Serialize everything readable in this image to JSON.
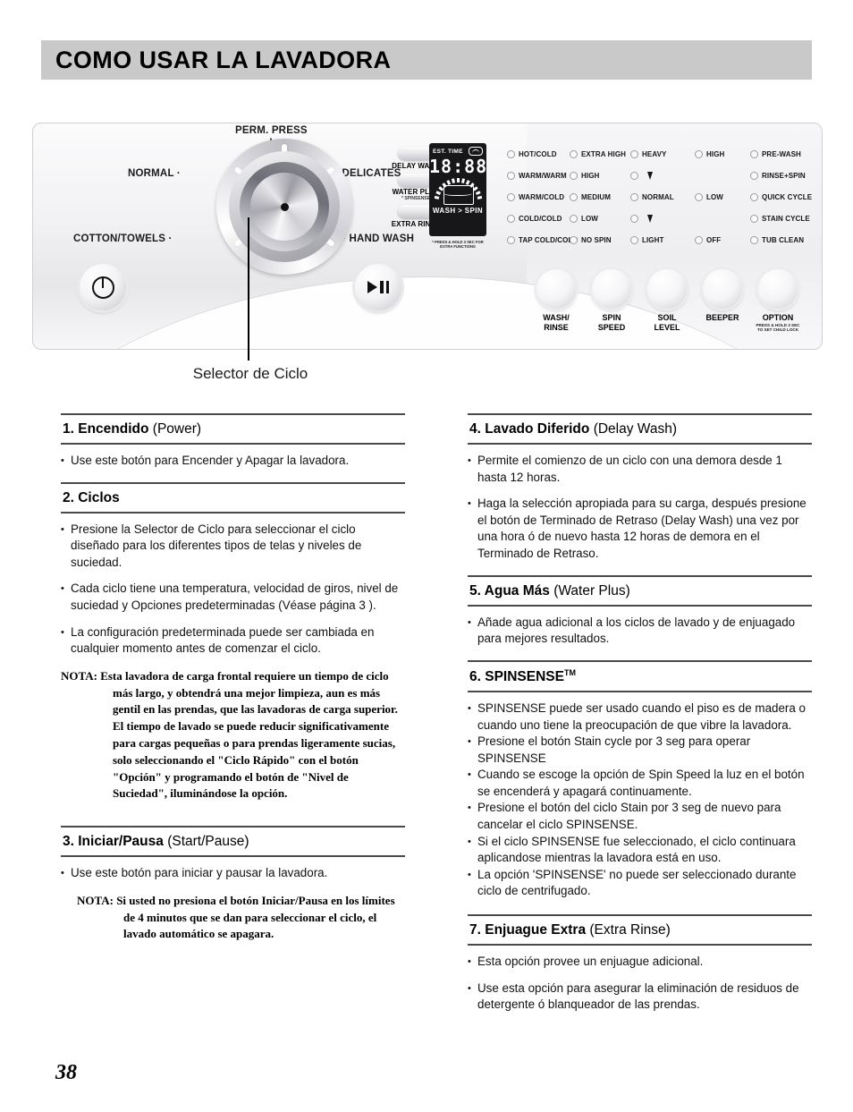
{
  "header": {
    "title": "COMO USAR LA LAVADORA"
  },
  "panel": {
    "dial": {
      "cycles": [
        {
          "label": "PERM. PRESS"
        },
        {
          "label": "NORMAL"
        },
        {
          "label": "COTTON/TOWELS"
        },
        {
          "label": "DELICATES"
        },
        {
          "label": "HAND WASH"
        }
      ]
    },
    "power_button": "power-icon",
    "start_button": "play-pause-icon",
    "pills": [
      {
        "label": "DELAY\nWASH",
        "sub": ""
      },
      {
        "label": "WATER PLUS",
        "sub": "* SPINSENSE"
      },
      {
        "label": "EXTRA RINSE",
        "sub": ""
      }
    ],
    "lcd": {
      "est_time_label": "EST. TIME",
      "digits": "18:88",
      "progress_label": "WASH > SPIN",
      "footnote": "* PRESS & HOLD 3 SEC\nFOR EXTRA FUNCTIONS"
    },
    "indicator_rows": [
      [
        "HOT/COLD",
        "EXTRA HIGH",
        "HEAVY",
        "HIGH",
        "PRE-WASH"
      ],
      [
        "WARM/WARM",
        "HIGH",
        "",
        "",
        "RINSE+SPIN"
      ],
      [
        "WARM/COLD",
        "MEDIUM",
        "NORMAL",
        "LOW",
        "QUICK CYCLE"
      ],
      [
        "COLD/COLD",
        "LOW",
        "",
        "",
        "STAIN CYCLE"
      ],
      [
        "TAP COLD/COLD",
        "NO SPIN",
        "LIGHT",
        "OFF",
        "TUB CLEAN"
      ]
    ],
    "option_buttons": [
      {
        "label": "WASH/\nRINSE",
        "sub": ""
      },
      {
        "label": "SPIN\nSPEED",
        "sub": ""
      },
      {
        "label": "SOIL\nLEVEL",
        "sub": ""
      },
      {
        "label": "BEEPER",
        "sub": ""
      },
      {
        "label": "OPTION",
        "sub": "PRESS & HOLD 3 SEC\nTO SET CHILD LOCK"
      }
    ]
  },
  "callout": {
    "label": "Selector de Ciclo"
  },
  "sections": {
    "s1": {
      "number_title": "1. Encendido",
      "paren": "(Power)",
      "bullets": [
        "Use este botón para Encender y Apagar la lavadora."
      ]
    },
    "s2": {
      "number_title": "2. Ciclos",
      "paren": "",
      "bullets": [
        "Presione la Selector de Ciclo para seleccionar el ciclo diseñado para los diferentes tipos de telas y niveles de suciedad.",
        "Cada ciclo tiene una temperatura, velocidad de giros, nivel de suciedad y Opciones predeterminadas (Véase página 3  ).",
        "La configuración predeterminada puede ser cambiada en cualquier momento antes de comenzar el ciclo."
      ],
      "note_label": "NOTA:",
      "note_body": "Esta lavadora de carga frontal requiere un tiempo de ciclo más largo, y obtendrá una mejor limpieza, aun es más gentil en las prendas, que las lavadoras de carga superior. El tiempo de lavado se puede reducir significativamente para cargas pequeñas o para prendas ligeramente sucias, solo seleccionando el \"Ciclo Rápido\" con el botón \"Opción\" y programando el botón de \"Nivel de Suciedad\", iluminándose la opción."
    },
    "s3": {
      "number_title": "3. Iniciar/Pausa",
      "paren": "(Start/Pause)",
      "bullets": [
        "Use este botón para iniciar y pausar la lavadora."
      ],
      "note_label": "NOTA:",
      "note_body": "Si usted no presiona el botón Iniciar/Pausa en los límites de 4 minutos que se dan para seleccionar el ciclo, el lavado automático se apagara."
    },
    "s4": {
      "number_title": "4. Lavado Diferido",
      "paren": "(Delay Wash)",
      "bullets": [
        "Permite el comienzo de un ciclo con una demora desde 1 hasta 12 horas.",
        "Haga la selección apropiada para su carga, después presione el botón de Terminado de Retraso (Delay Wash) una vez por una hora ó de nuevo hasta 12 horas de demora en el Terminado de Retraso."
      ]
    },
    "s5": {
      "number_title": "5. Agua Más",
      "paren": "(Water Plus)",
      "bullets": [
        "Añade agua adicional a los ciclos de lavado y de enjuagado para mejores resultados."
      ]
    },
    "s6": {
      "number_title": "6. SPINSENSE",
      "tm": "TM",
      "paren": "",
      "bullets": [
        "SPINSENSE puede ser usado cuando el piso es de madera o cuando uno tiene la preocupación de que vibre la lavadora.",
        "Presione el botón Stain cycle por 3 seg para operar SPINSENSE",
        "Cuando se escoge la opción de Spin Speed la luz en el botón se encenderá y apagará continuamente.",
        "Presione el botón del ciclo Stain por 3 seg de nuevo para cancelar el ciclo SPINSENSE.",
        "Si el ciclo SPINSENSE fue seleccionado, el ciclo continuara aplicandose mientras la lavadora está en uso.",
        "La opción 'SPINSENSE' no puede ser seleccionado durante ciclo de centrifugado."
      ]
    },
    "s7": {
      "number_title": "7. Enjuague Extra",
      "paren": "(Extra Rinse)",
      "bullets": [
        "Esta opción provee un enjuague adicional.",
        "Use esta opción para asegurar la eliminación de residuos de detergente ó blanqueador de las prendas."
      ]
    }
  },
  "page_number": "38"
}
